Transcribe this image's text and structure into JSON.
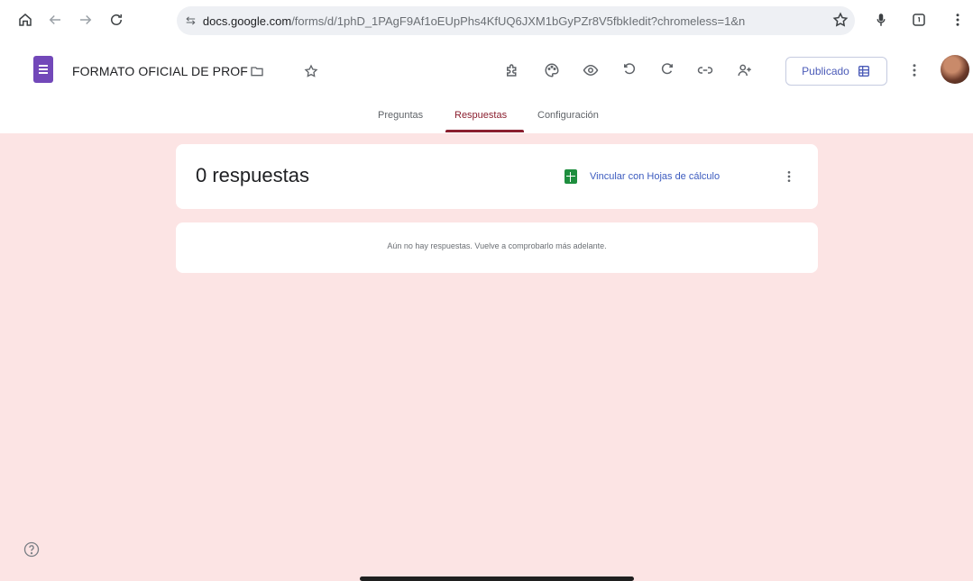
{
  "browser": {
    "url_host": "docs.google.com",
    "url_path": "/forms/d/1phD_1PAgF9Af1oEUpPhs4KfUQ6JXM1bGyPZr8V5fbkIedit?chromeless=1&n"
  },
  "header": {
    "doc_title": "FORMATO OFICIAL DE PROF",
    "publish_label": "Publicado"
  },
  "tabs": [
    {
      "label": "Preguntas",
      "active": false
    },
    {
      "label": "Respuestas",
      "active": true
    },
    {
      "label": "Configuración",
      "active": false
    }
  ],
  "summary": {
    "count_label": "0 respuestas",
    "sheets_link": "Vincular con Hojas de cálculo"
  },
  "empty_state": {
    "message": "Aún no hay respuestas. Vuelve a comprobarlo más adelante."
  },
  "colors": {
    "background": "#fce4e4",
    "accent": "#8b1f2f",
    "forms_purple": "#7248b9",
    "sheets_green": "#1e8e3e"
  },
  "icons": {
    "browser": [
      "home-icon",
      "back-icon",
      "forward-icon",
      "reload-icon",
      "site-info-icon",
      "bookmark-star-icon",
      "mic-icon",
      "tab-switcher-icon",
      "browser-menu-icon"
    ],
    "toolbar": [
      "addon-puzzle-icon",
      "palette-icon",
      "preview-eye-icon",
      "undo-icon",
      "redo-icon",
      "link-icon",
      "add-collaborator-icon",
      "more-vert-icon"
    ]
  }
}
